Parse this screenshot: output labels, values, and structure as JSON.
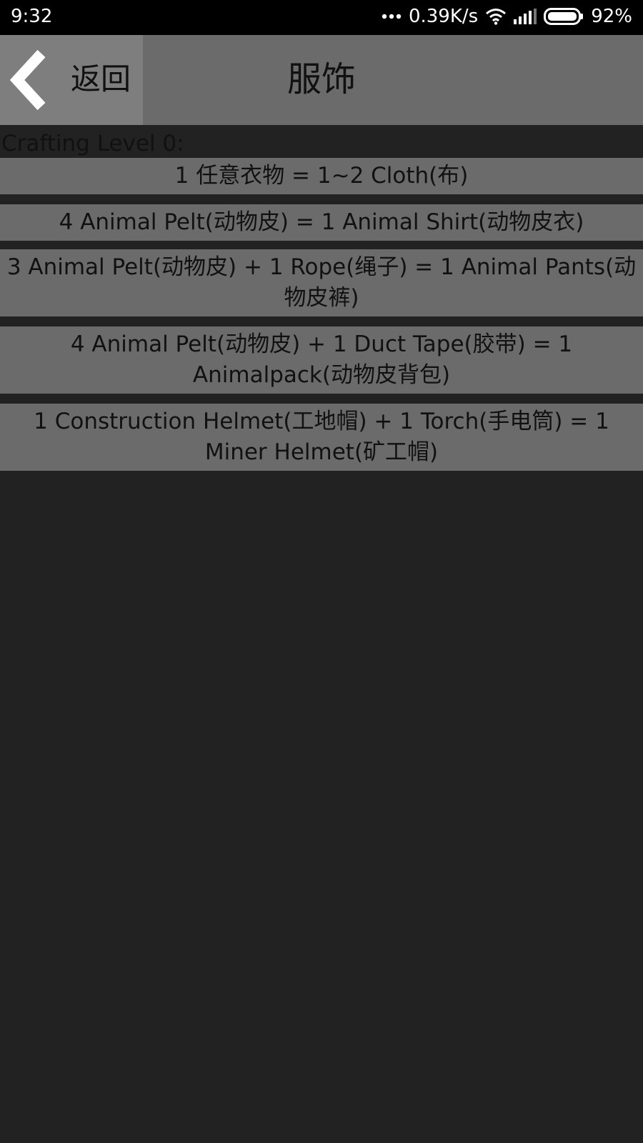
{
  "status": {
    "time": "9:32",
    "network_speed": "0.39K/s",
    "battery": "92%",
    "icons": [
      "more-dots-icon",
      "wifi-icon",
      "signal-icon",
      "battery-icon"
    ]
  },
  "header": {
    "back_label": "返回",
    "title": "服饰",
    "back_icon": "chevron-left-icon"
  },
  "section": {
    "label": "Crafting Level 0:"
  },
  "recipes": [
    "1 任意衣物 = 1~2 Cloth(布)",
    "4 Animal Pelt(动物皮) = 1 Animal Shirt(动物皮衣)",
    "3 Animal Pelt(动物皮) + 1 Rope(绳子) = 1 Animal Pants(动物皮裤)",
    "4 Animal Pelt(动物皮) + 1 Duct Tape(胶带) = 1 Animalpack(动物皮背包)",
    "1 Construction Helmet(工地帽) + 1 Torch(手电筒) = 1 Miner Helmet(矿工帽)"
  ],
  "colors": {
    "background": "#222222",
    "header": "#6b6b6b",
    "back_button": "#7e7e7e",
    "row": "#6b6b6b",
    "text": "#111111"
  }
}
